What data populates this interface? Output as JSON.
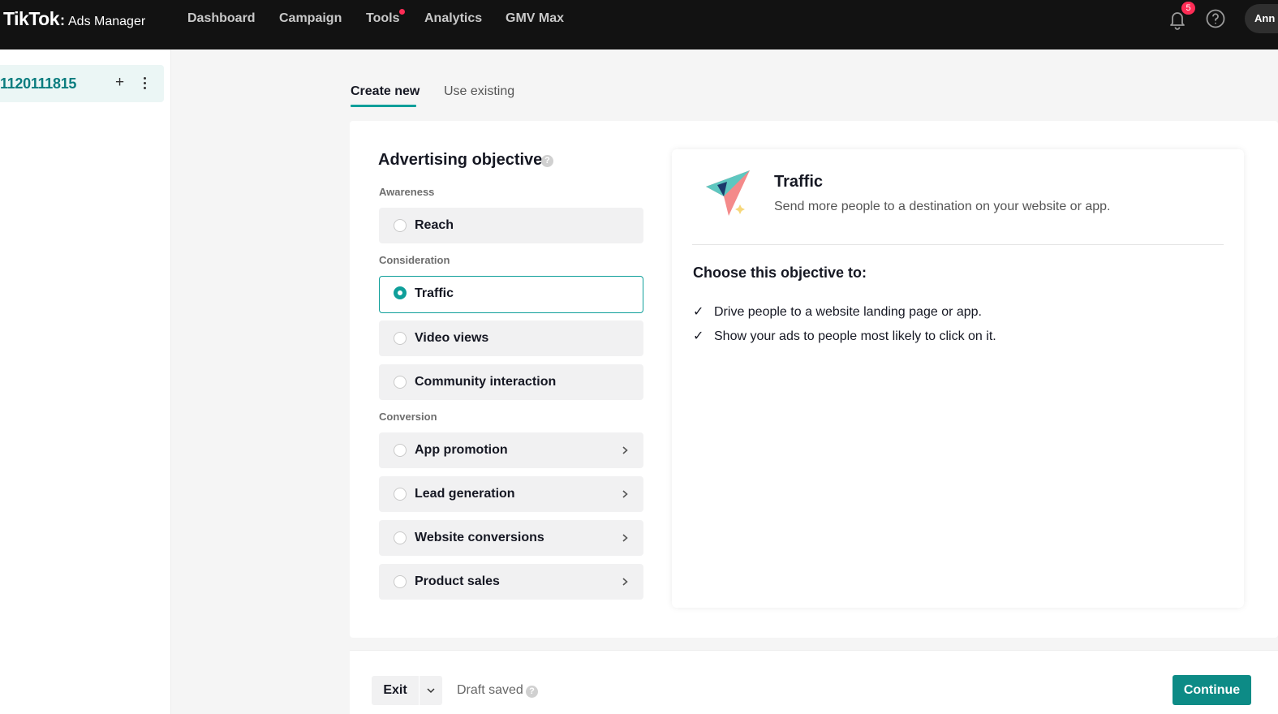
{
  "header": {
    "logo_main": "TikTok",
    "logo_sep": ":",
    "logo_sub": "Ads Manager",
    "nav": [
      {
        "label": "Dashboard"
      },
      {
        "label": "Campaign"
      },
      {
        "label": "Tools",
        "has_dot": true
      },
      {
        "label": "Analytics"
      },
      {
        "label": "GMV Max"
      }
    ],
    "notifications_count": "5",
    "avatar_text": "Ann"
  },
  "sidebar": {
    "item_name": "1120111815",
    "add_icon": "+",
    "more_icon": "more-vertical-icon"
  },
  "tabs": [
    {
      "label": "Create new",
      "active": true
    },
    {
      "label": "Use existing",
      "active": false
    }
  ],
  "objective": {
    "title": "Advertising objective",
    "help_icon": "?",
    "groups": [
      {
        "label": "Awareness",
        "options": [
          {
            "label": "Reach",
            "selected": false,
            "has_chevron": false
          }
        ]
      },
      {
        "label": "Consideration",
        "options": [
          {
            "label": "Traffic",
            "selected": true,
            "has_chevron": false
          },
          {
            "label": "Video views",
            "selected": false,
            "has_chevron": false
          },
          {
            "label": "Community interaction",
            "selected": false,
            "has_chevron": false
          }
        ]
      },
      {
        "label": "Conversion",
        "options": [
          {
            "label": "App promotion",
            "selected": false,
            "has_chevron": true
          },
          {
            "label": "Lead generation",
            "selected": false,
            "has_chevron": true
          },
          {
            "label": "Website conversions",
            "selected": false,
            "has_chevron": true
          },
          {
            "label": "Product sales",
            "selected": false,
            "has_chevron": true
          }
        ]
      }
    ]
  },
  "panel": {
    "title": "Traffic",
    "description": "Send more people to a destination on your website or app.",
    "choose_title": "Choose this objective to:",
    "bullets": [
      "Drive people to a website landing page or app.",
      "Show your ads to people most likely to click on it."
    ],
    "icon": "paper-plane-icon"
  },
  "footer": {
    "exit_label": "Exit",
    "draft_label": "Draft saved",
    "continue_label": "Continue"
  },
  "colors": {
    "accent": "#0f9f9a",
    "continue_bg": "#0d8b86",
    "topbar": "#121212",
    "badge": "#fe2c55"
  }
}
